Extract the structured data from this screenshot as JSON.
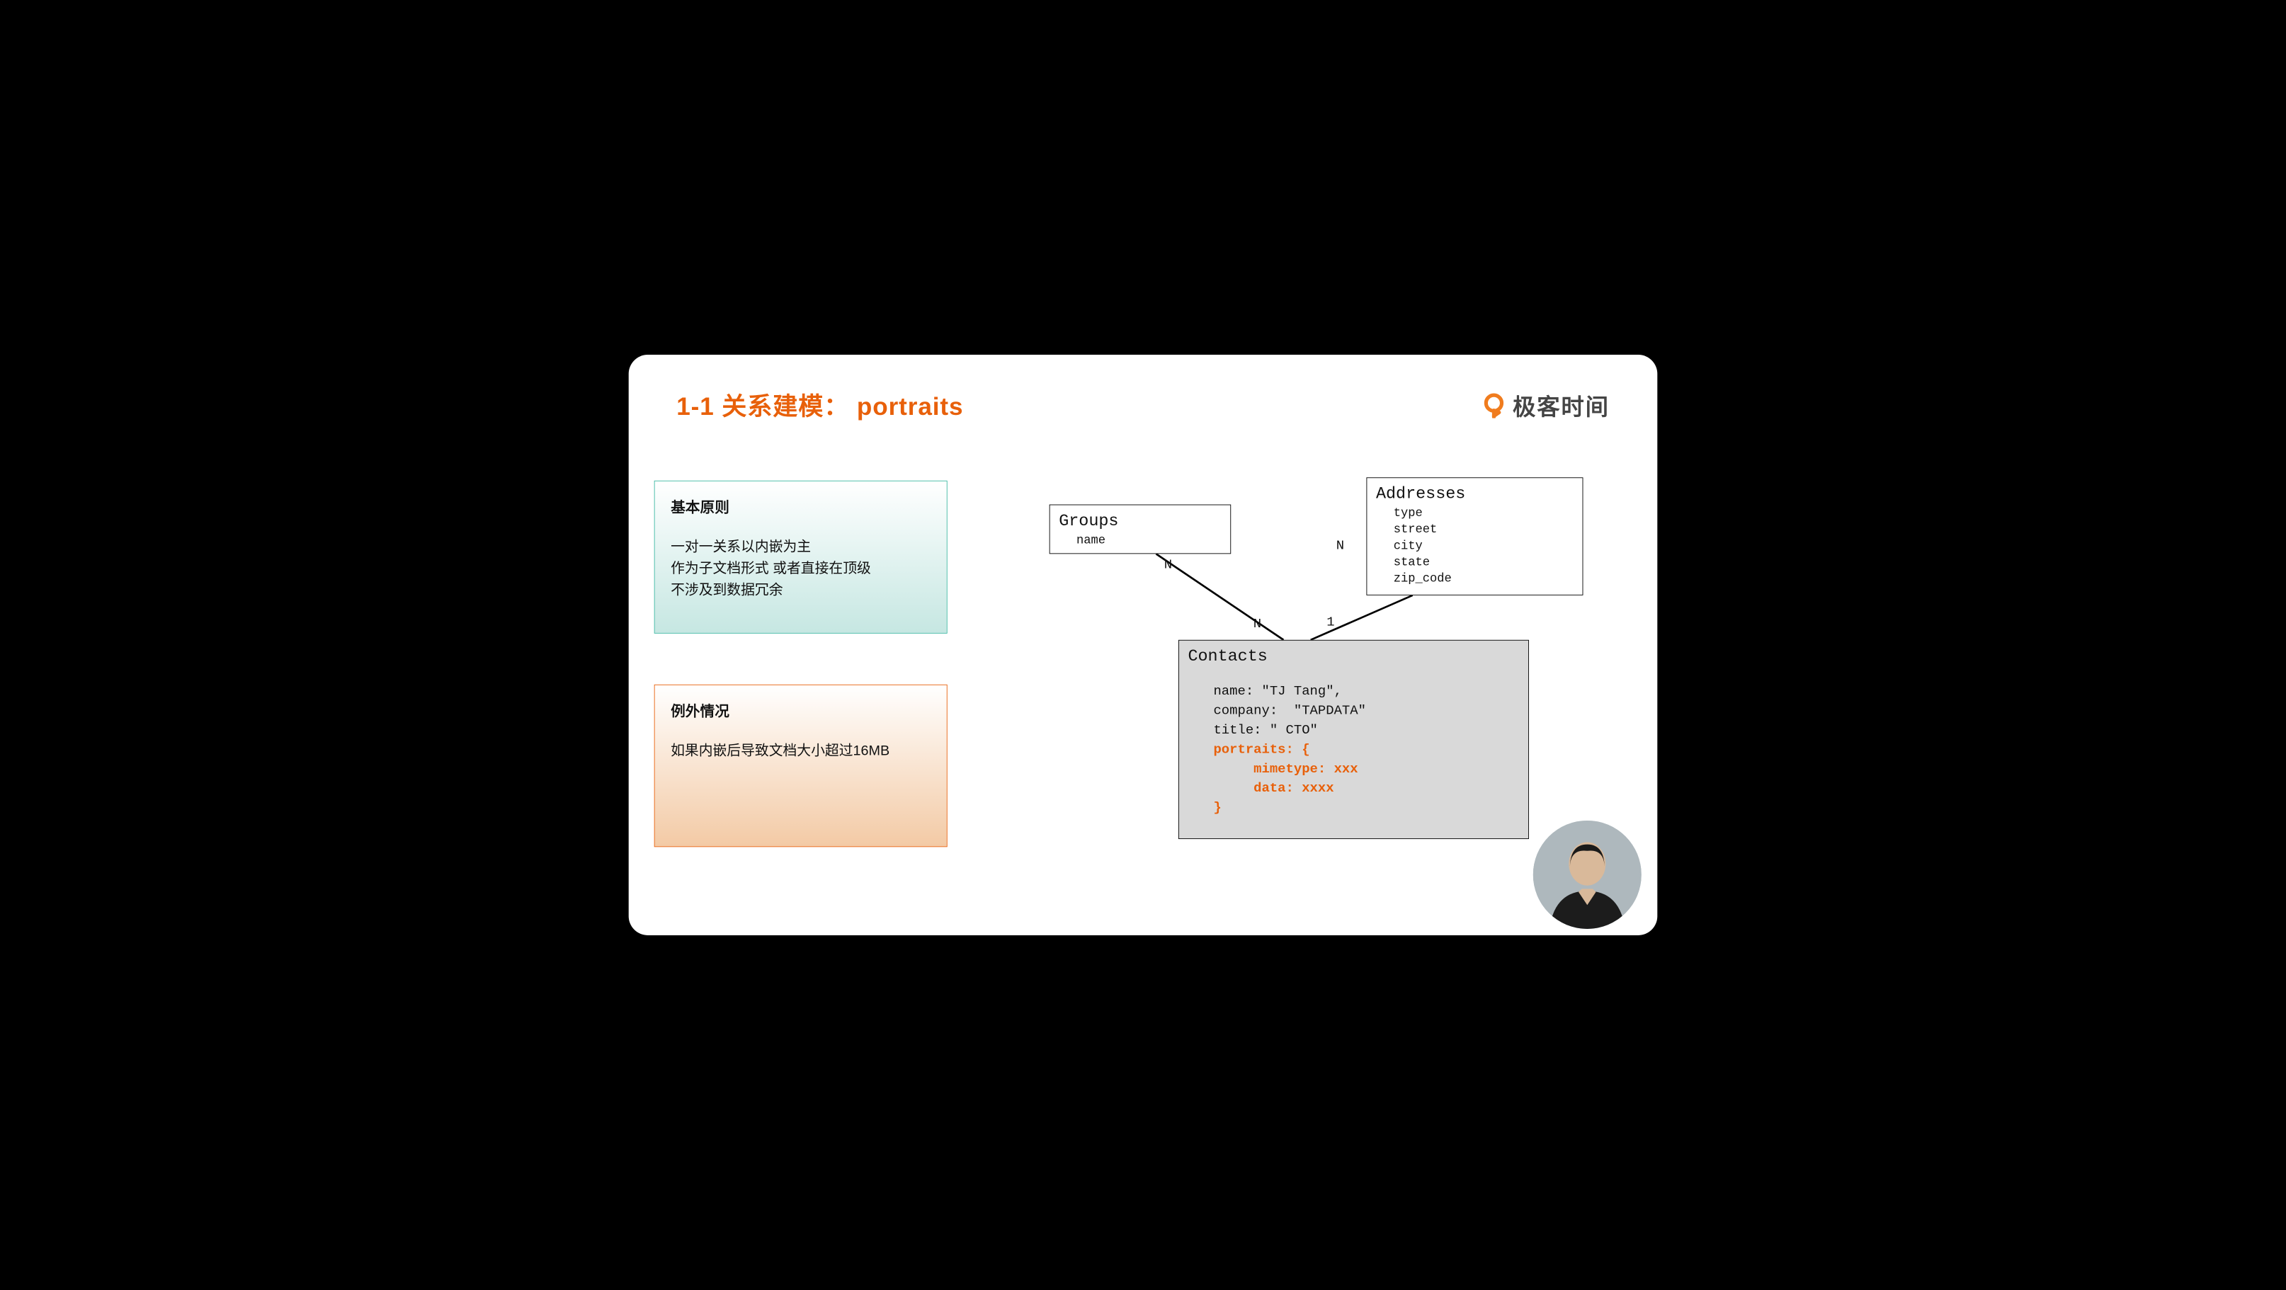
{
  "slide": {
    "title": "1-1 关系建模： portraits"
  },
  "brand": {
    "text": "极客时间"
  },
  "principles": {
    "heading": "基本原则",
    "lines": [
      "一对一关系以内嵌为主",
      "作为子文档形式 或者直接在顶级",
      "不涉及到数据冗余"
    ]
  },
  "exceptions": {
    "heading": "例外情况",
    "lines": [
      "如果内嵌后导致文档大小超过16MB"
    ]
  },
  "diagram": {
    "entities": {
      "groups": {
        "title": "Groups",
        "fields": [
          "name"
        ]
      },
      "addresses": {
        "title": "Addresses",
        "fields": [
          "type",
          "street",
          "city",
          "state",
          "zip_code"
        ]
      },
      "contacts": {
        "title": "Contacts",
        "doc_plain": [
          "name: \"TJ Tang\",",
          "company:  \"TAPDATA\"",
          "title: \" CTO\""
        ],
        "doc_highlight": [
          "portraits: {",
          "     mimetype: xxx",
          "     data: xxxx",
          "}"
        ]
      }
    },
    "relationships": [
      {
        "from": "Groups",
        "to": "Contacts",
        "from_card": "N",
        "to_card": "N"
      },
      {
        "from": "Addresses",
        "to": "Contacts",
        "from_card": "N",
        "to_card": "1"
      }
    ],
    "cardinality_labels": {
      "groups_side": "N",
      "contacts_left": "N",
      "addresses_side": "N",
      "contacts_right": "1"
    }
  }
}
